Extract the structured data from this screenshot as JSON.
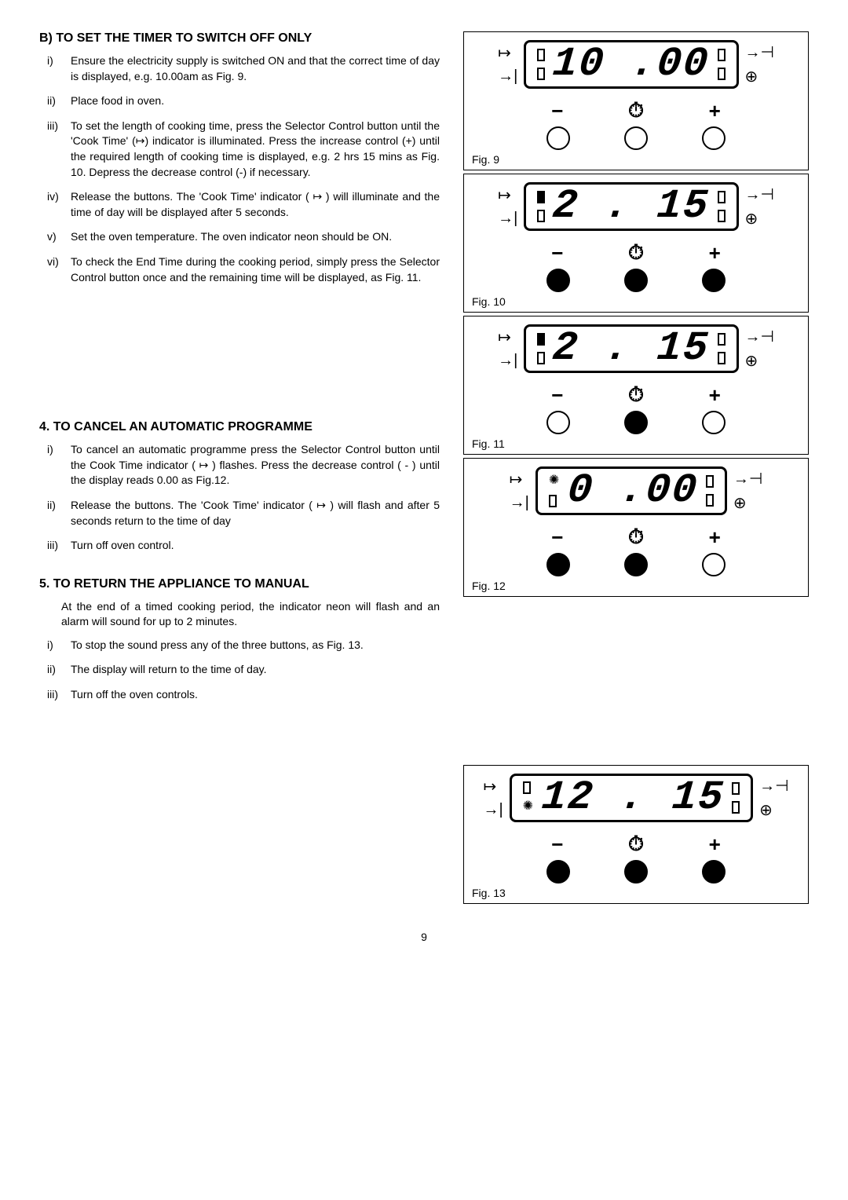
{
  "sectionB": {
    "heading": "B) TO SET THE TIMER TO SWITCH OFF ONLY",
    "items": [
      {
        "r": "i)",
        "t": "Ensure the electricity supply is switched ON and that the correct time of day is displayed, e.g. 10.00am as Fig. 9."
      },
      {
        "r": "ii)",
        "t": "Place food  in oven."
      },
      {
        "r": "iii)",
        "t": "To set the length of cooking  time, press the Selector Control button until the 'Cook Time' (↦) indicator is illuminated.  Press the increase control (+) until the required length of cooking time is displayed, e.g. 2 hrs 15 mins as Fig. 10.  Depress the decrease control (-) if necessary."
      },
      {
        "r": "iv)",
        "t": "Release the buttons. The 'Cook Time' indicator ( ↦ ) will illuminate and the time of day will be displayed after 5 seconds."
      },
      {
        "r": "v)",
        "t": "Set the oven temperature.  The oven indicator neon should  be ON."
      },
      {
        "r": "vi)",
        "t": "To check the End Time during  the cooking period,  simply  press  the Selector Control button once  and the remaining  time will be displayed, as Fig. 11."
      }
    ]
  },
  "section4": {
    "heading": "4. TO CANCEL AN AUTOMATIC PROGRAMME",
    "items": [
      {
        "r": "i)",
        "t": "To cancel an  automatic programme press the Selector Control button until the Cook Time indicator ( ↦ ) flashes.  Press the decrease control ( - ) until the display reads 0.00 as Fig.12."
      },
      {
        "r": "ii)",
        "t": "Release the buttons.  The 'Cook Time' indicator ( ↦ ) will flash and after 5 seconds return to the time of day"
      },
      {
        "r": "iii)",
        "t": "Turn off oven control."
      }
    ]
  },
  "section5": {
    "heading": "5. TO RETURN THE APPLIANCE TO MANUAL",
    "intro": "At the end of a timed cooking period, the indicator neon will flash and an alarm will sound for up to 2 minutes.",
    "items": [
      {
        "r": "i)",
        "t": "To stop the sound press any of the three buttons, as Fig. 13."
      },
      {
        "r": "ii)",
        "t": "The display will return to the time of day."
      },
      {
        "r": "iii)",
        "t": "Turn off the oven controls."
      }
    ]
  },
  "figs": {
    "f9": {
      "label": "Fig. 9",
      "value": "10 .00",
      "leftInd": [
        "empty",
        "empty"
      ],
      "rightInd": [
        "empty",
        "empty"
      ],
      "circles": [
        "open",
        "open",
        "open"
      ]
    },
    "f10": {
      "label": "Fig. 10",
      "value": "2 . 15",
      "leftInd": [
        "filled",
        "empty"
      ],
      "rightInd": [
        "empty",
        "empty"
      ],
      "circles": [
        "filled",
        "filled",
        "filled"
      ]
    },
    "f11": {
      "label": "Fig. 11",
      "value": "2 . 15",
      "leftInd": [
        "filled",
        "empty"
      ],
      "rightInd": [
        "empty",
        "empty"
      ],
      "circles": [
        "open",
        "filled",
        "open"
      ]
    },
    "f12": {
      "label": "Fig. 12",
      "value": "0 .00",
      "leftInd": [
        "burst",
        "empty"
      ],
      "rightInd": [
        "empty",
        "empty"
      ],
      "circles": [
        "filled",
        "filled",
        "open"
      ]
    },
    "f13": {
      "label": "Fig. 13",
      "value": "12 . 15",
      "leftInd": [
        "empty",
        "burst"
      ],
      "rightInd": [
        "empty",
        "empty"
      ],
      "circles": [
        "filled",
        "filled",
        "filled"
      ]
    }
  },
  "buttons": {
    "minus": "−",
    "plus": "+",
    "clock": "⏱"
  },
  "page": "9"
}
